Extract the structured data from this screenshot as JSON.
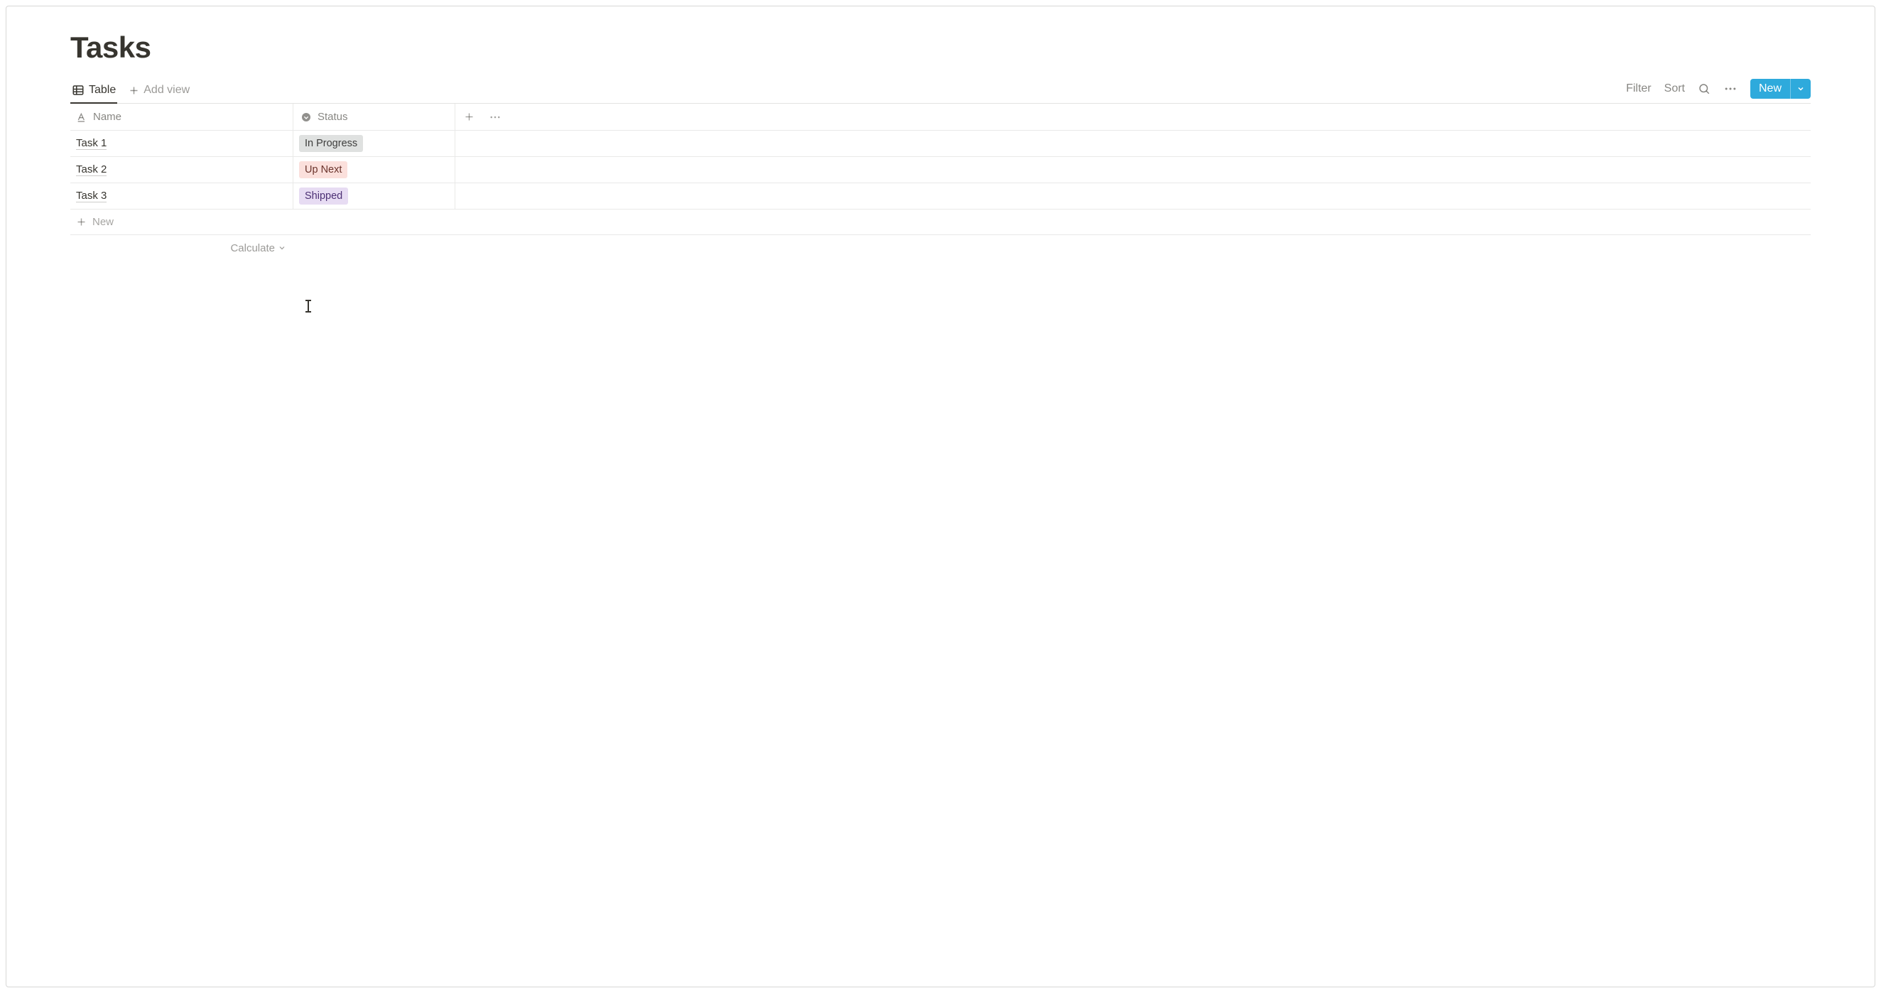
{
  "page": {
    "title": "Tasks"
  },
  "views": {
    "active": {
      "label": "Table"
    },
    "add_view_label": "Add view"
  },
  "toolbar": {
    "filter_label": "Filter",
    "sort_label": "Sort",
    "new_label": "New"
  },
  "columns": {
    "name_label": "Name",
    "status_label": "Status"
  },
  "statuses": {
    "In Progress": {
      "bg": "#dfe1e0",
      "fg": "#3d3d3c"
    },
    "Up Next": {
      "bg": "#fbe0dc",
      "fg": "#6a332b"
    },
    "Shipped": {
      "bg": "#e7dcf3",
      "fg": "#4c2f74"
    }
  },
  "rows": [
    {
      "name": "Task 1",
      "status": "In Progress"
    },
    {
      "name": "Task 2",
      "status": "Up Next"
    },
    {
      "name": "Task 3",
      "status": "Shipped"
    }
  ],
  "footer": {
    "new_row_label": "New",
    "calculate_label": "Calculate"
  }
}
